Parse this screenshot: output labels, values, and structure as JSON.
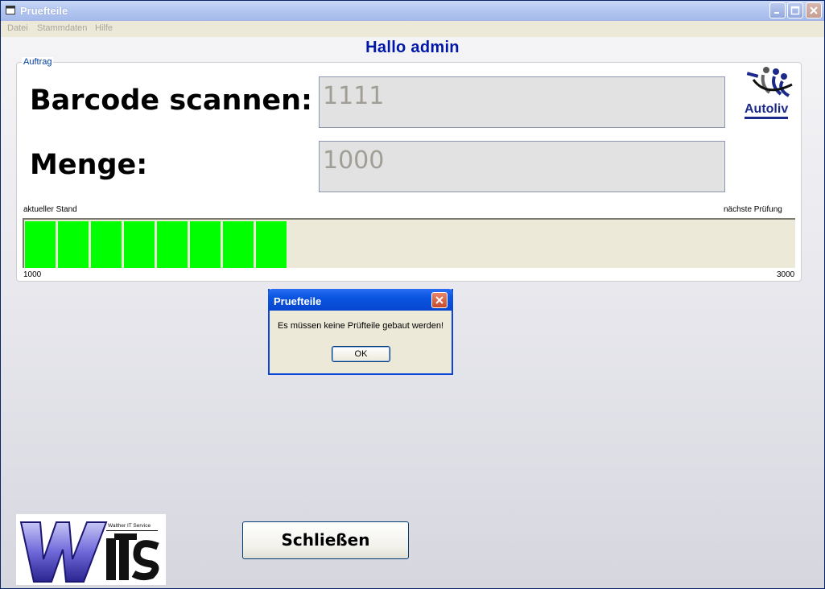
{
  "window": {
    "title": "Pruefteile"
  },
  "menu": {
    "items": [
      "Datei",
      "Stammdaten",
      "Hilfe"
    ]
  },
  "greeting": "Hallo admin",
  "group": {
    "label": "Auftrag",
    "barcode_label": "Barcode scannen:",
    "barcode_value": "1111",
    "menge_label": "Menge:",
    "menge_value": "1000"
  },
  "autoliv_logo": {
    "text": "Autoliv"
  },
  "progress": {
    "left_label": "aktueller Stand",
    "right_label": "nächste Prüfung",
    "min_label": "1000",
    "max_label": "3000",
    "filled_segments": 8,
    "fill_fraction": 0.34,
    "color": "#00ff00"
  },
  "dialog": {
    "title": "Pruefteile",
    "message": "Es müssen keine Prüfteile gebaut werden!",
    "ok_label": "OK"
  },
  "wits_logo": {
    "text": "Walther IT Service"
  },
  "close_button": {
    "label": "Schließen"
  }
}
